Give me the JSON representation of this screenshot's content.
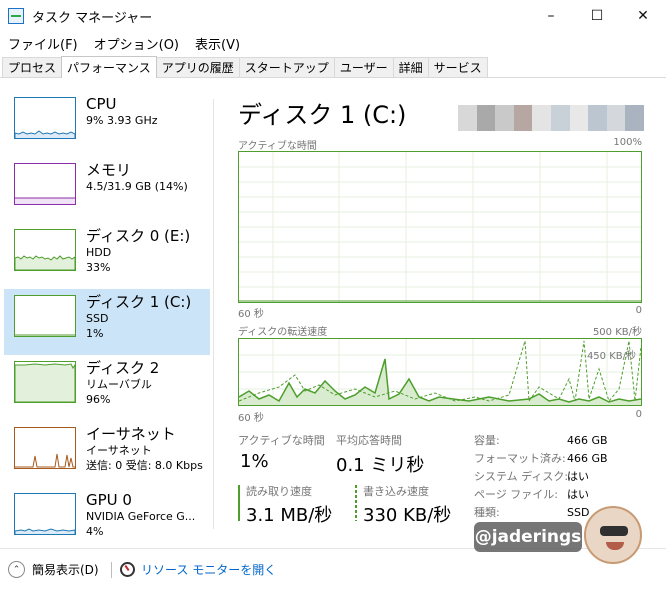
{
  "window": {
    "title": "タスク マネージャー",
    "controls": [
      "–",
      "☐",
      "✕"
    ]
  },
  "menu": [
    "ファイル(F)",
    "オプション(O)",
    "表示(V)"
  ],
  "tabs": [
    {
      "label": "プロセス",
      "active": false
    },
    {
      "label": "パフォーマンス",
      "active": true
    },
    {
      "label": "アプリの履歴",
      "active": false
    },
    {
      "label": "スタートアップ",
      "active": false
    },
    {
      "label": "ユーザー",
      "active": false
    },
    {
      "label": "詳細",
      "active": false
    },
    {
      "label": "サービス",
      "active": false
    }
  ],
  "sidebar": {
    "items": [
      {
        "name": "CPU",
        "sub1": "9%  3.93 GHz",
        "sub2": "",
        "color": "#1f78b4",
        "active": false
      },
      {
        "name": "メモリ",
        "sub1": "4.5/31.9 GB (14%)",
        "sub2": "",
        "color": "#8b2ca8",
        "active": false
      },
      {
        "name": "ディスク 0 (E:)",
        "sub1": "HDD",
        "sub2": "33%",
        "color": "#4d9e2c",
        "active": false
      },
      {
        "name": "ディスク 1 (C:)",
        "sub1": "SSD",
        "sub2": "1%",
        "color": "#4d9e2c",
        "active": true
      },
      {
        "name": "ディスク 2",
        "sub1": "リムーバブル",
        "sub2": "96%",
        "color": "#4d9e2c",
        "active": false
      },
      {
        "name": "イーサネット",
        "sub1": "イーサネット",
        "sub2": "送信: 0  受信: 8.0 Kbps",
        "color": "#a65a1e",
        "active": false
      },
      {
        "name": "GPU 0",
        "sub1": "NVIDIA GeForce G...",
        "sub2": "4%",
        "color": "#1f78b4",
        "active": false
      }
    ]
  },
  "main": {
    "title": "ディスク 1 (C:)",
    "graph1": {
      "label": "アクティブな時間",
      "max": "100%",
      "x_left": "60 秒",
      "x_right": "0"
    },
    "graph2": {
      "label": "ディスクの転送速度",
      "max": "500 KB/秒",
      "inner": "450 KB/秒",
      "x_left": "60 秒",
      "x_right": "0"
    },
    "stats": {
      "active_label": "アクティブな時間",
      "active_value": "1%",
      "response_label": "平均応答時間",
      "response_value": "0.1 ミリ秒",
      "read_label": "読み取り速度",
      "read_value": "3.1 MB/秒",
      "write_label": "書き込み速度",
      "write_value": "330 KB/秒"
    },
    "properties": [
      {
        "key": "容量:",
        "value": "466 GB"
      },
      {
        "key": "フォーマット済み:",
        "value": "466 GB"
      },
      {
        "key": "システム ディスク:",
        "value": "はい"
      },
      {
        "key": "ページ ファイル:",
        "value": "はい"
      },
      {
        "key": "種類:",
        "value": "SSD"
      }
    ]
  },
  "footer": {
    "collapse_label": "簡易表示(D)",
    "resmon_label": "リソース モニターを開く"
  },
  "watermark": {
    "text": "@jaderings"
  },
  "colors": {
    "cpu": "#1f78b4",
    "memory": "#8b2ca8",
    "disk": "#4d9e2c",
    "ethernet": "#a65a1e",
    "selection": "#cce4f7",
    "link": "#0066cc"
  }
}
